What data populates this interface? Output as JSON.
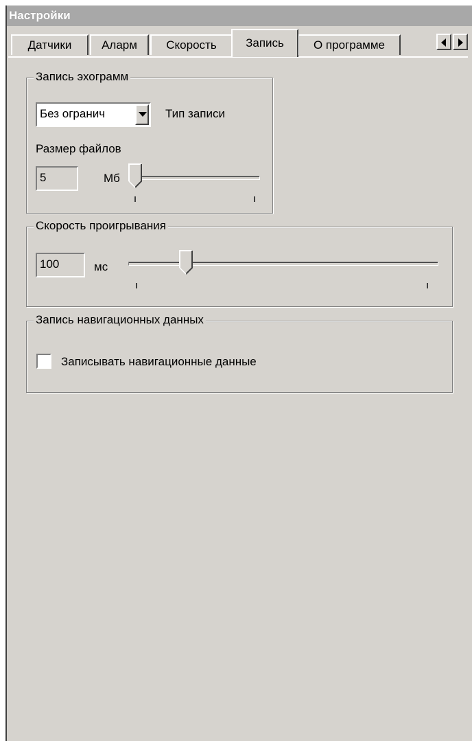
{
  "window": {
    "title": "Настройки"
  },
  "tabs": [
    {
      "label": "Датчики"
    },
    {
      "label": "Аларм"
    },
    {
      "label": "Скорость"
    },
    {
      "label": "Запись"
    },
    {
      "label": "О программе"
    }
  ],
  "active_tab": "Запись",
  "echo_recording": {
    "legend": "Запись эхограмм",
    "record_type_value": "Без огранич",
    "record_type_label": "Тип записи",
    "file_size_label": "Размер файлов",
    "file_size_value": "5",
    "file_size_unit": "Мб",
    "file_size_slider_fraction": 0.0
  },
  "playback_speed": {
    "legend": "Скорость проигрывания",
    "value": "100",
    "unit": "мс",
    "slider_fraction": 0.2
  },
  "nav_recording": {
    "legend": "Запись навигационных данных",
    "checkbox_label": "Записывать навигационные данные",
    "checked": false
  }
}
